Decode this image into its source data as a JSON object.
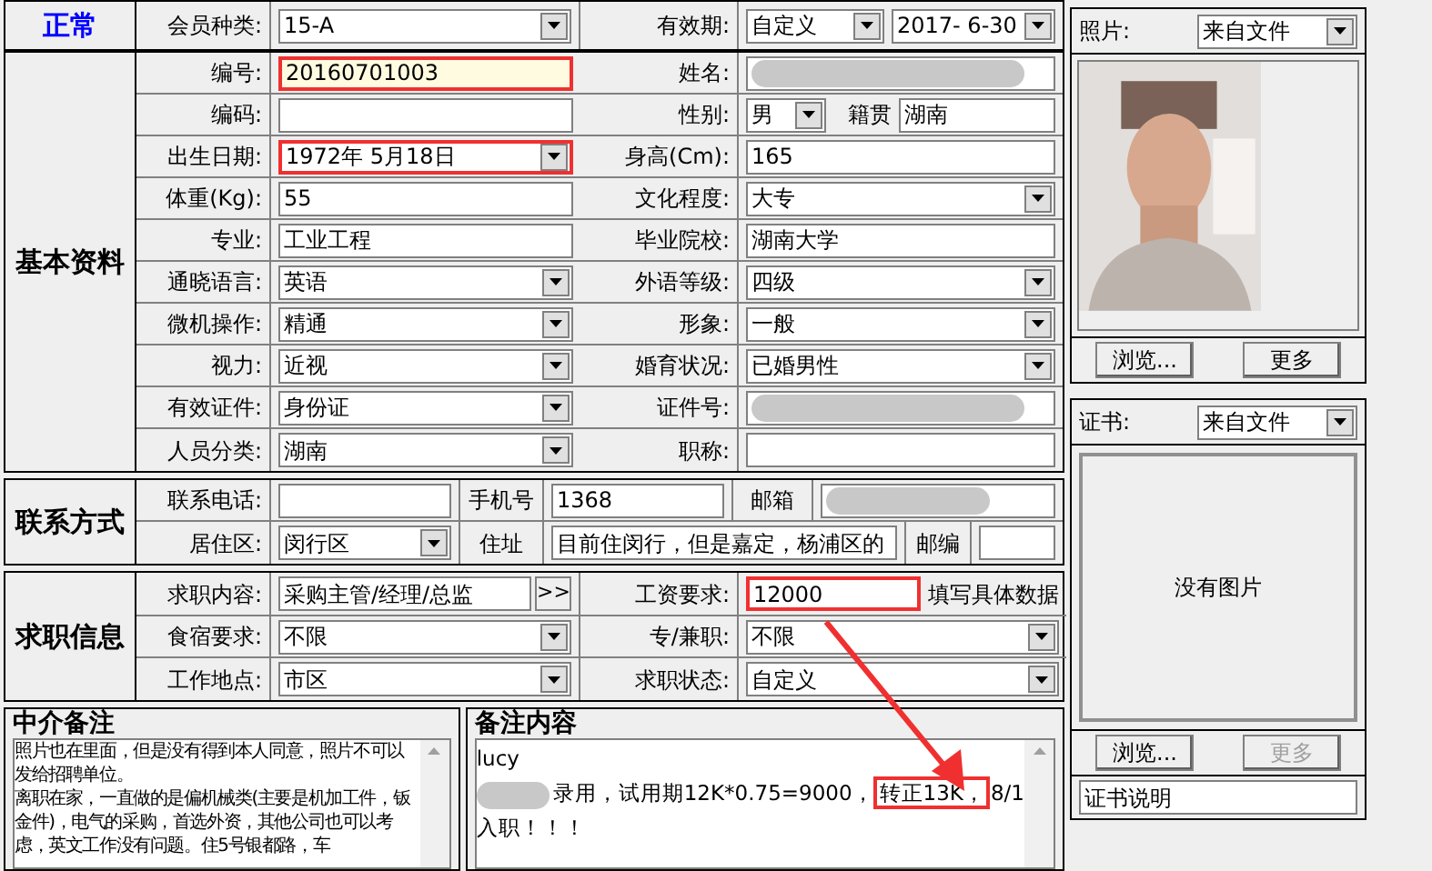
{
  "header": {
    "status": "正常",
    "member_type": {
      "label": "会员种类:",
      "value": "15-A"
    },
    "validity": {
      "label": "有效期:",
      "mode": "自定义",
      "date": "2017- 6-30"
    }
  },
  "basic": {
    "title": "基本资料",
    "rows": [
      [
        {
          "label": "编号:",
          "kind": "text",
          "value": "20160701003",
          "highlighted": true,
          "annotated": true
        },
        {
          "label": "姓名:",
          "kind": "redacted"
        }
      ],
      [
        {
          "label": "编码:",
          "kind": "text"
        },
        {
          "label": "性别:",
          "kind": "pair",
          "value": "男",
          "extra_label": "籍贯",
          "extra_value": "湖南"
        }
      ],
      [
        {
          "label": "出生日期:",
          "kind": "combo",
          "value": "1972年 5月18日",
          "annotated": true
        },
        {
          "label": "身高(Cm):",
          "kind": "text",
          "value": "165"
        }
      ],
      [
        {
          "label": "体重(Kg):",
          "kind": "text",
          "value": "55"
        },
        {
          "label": "文化程度:",
          "kind": "combo",
          "value": "大专"
        }
      ],
      [
        {
          "label": "专业:",
          "kind": "text",
          "value": "工业工程"
        },
        {
          "label": "毕业院校:",
          "kind": "text",
          "value": "湖南大学"
        }
      ],
      [
        {
          "label": "通晓语言:",
          "kind": "combo",
          "value": "英语"
        },
        {
          "label": "外语等级:",
          "kind": "combo",
          "value": "四级"
        }
      ],
      [
        {
          "label": "微机操作:",
          "kind": "combo",
          "value": "精通"
        },
        {
          "label": "形象:",
          "kind": "combo",
          "value": "一般"
        }
      ],
      [
        {
          "label": "视力:",
          "kind": "combo",
          "value": "近视"
        },
        {
          "label": "婚育状况:",
          "kind": "combo",
          "value": "已婚男性"
        }
      ],
      [
        {
          "label": "有效证件:",
          "kind": "combo",
          "value": "身份证"
        },
        {
          "label": "证件号:",
          "kind": "redacted"
        }
      ],
      [
        {
          "label": "人员分类:",
          "kind": "combo",
          "value": "湖南"
        },
        {
          "label": "职称:",
          "kind": "text"
        }
      ]
    ]
  },
  "contact": {
    "title": "联系方式",
    "phone_label": "联系电话:",
    "mobile_label": "手机号",
    "mobile_value": "1368",
    "email_label": "邮箱",
    "district_label": "居住区:",
    "district": "闵行区",
    "address_label": "住址",
    "address": "目前住闵行，但是嘉定，杨浦区的",
    "zip_label": "邮编"
  },
  "job": {
    "title": "求职信息",
    "content_label": "求职内容:",
    "content": "采购主管/经理/总监",
    "more_button": ">>",
    "salary_label": "工资要求:",
    "salary": "12000",
    "salary_annotated": true,
    "salary_hint": "填写具体数据",
    "rows": [
      [
        {
          "label": "食宿要求:",
          "value": "不限"
        },
        {
          "label": "专/兼职:",
          "value": "不限"
        }
      ],
      [
        {
          "label": "工作地点:",
          "value": "市区"
        },
        {
          "label": "求职状态:",
          "value": "自定义"
        }
      ]
    ]
  },
  "agency_notes": {
    "title": "中介备注",
    "paragraphs": [
      "照片也在里面，但是没有得到本人同意，照片不可以发给招聘单位。",
      "离职在家，一直做的是偏机械类(主要是机加工件，钣金件)，电气的采购，首选外资，其他公司也可以考虑，英文工作没有问题。住5号银都路，车"
    ]
  },
  "remarks": {
    "title": "备注内容",
    "lines": [
      {
        "redacted_prefix": false,
        "parts": [
          {
            "text": "lucy",
            "annotated": false
          }
        ]
      },
      {
        "redacted_prefix": true,
        "parts": [
          {
            "text": "录用，试用期12K*0.75=9000，",
            "annotated": false
          },
          {
            "text": "转正13K，",
            "annotated": true
          },
          {
            "text": "8/1",
            "annotated": false
          }
        ]
      },
      {
        "redacted_prefix": false,
        "parts": [
          {
            "text": "入职！！！",
            "annotated": false
          }
        ]
      }
    ]
  },
  "photo": {
    "label": "照片:",
    "source": "来自文件",
    "buttons": [
      {
        "label": "浏览...",
        "disabled": false
      },
      {
        "label": "更多",
        "disabled": false
      }
    ]
  },
  "certificate": {
    "label": "证书:",
    "source": "来自文件",
    "empty_text": "没有图片",
    "buttons": [
      {
        "label": "浏览...",
        "disabled": false
      },
      {
        "label": "更多",
        "disabled": true
      }
    ],
    "caption": "证书说明"
  }
}
